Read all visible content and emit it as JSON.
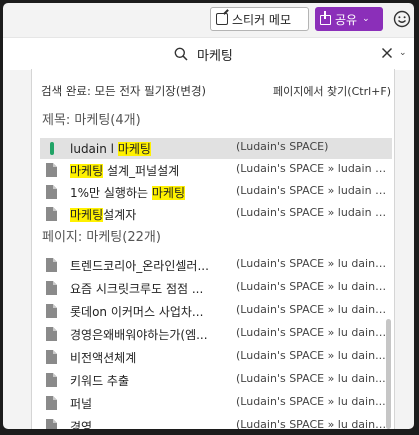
{
  "toolbar": {
    "sticker_label": "스티커 메모",
    "share_label": "공유",
    "share_chevron": "⌄",
    "colors": {
      "share_bg": "#8b2fb9"
    }
  },
  "search": {
    "value": "마케팅",
    "placeholder": "",
    "clear_glyph": "✕",
    "dropdown_glyph": "⌄"
  },
  "panel": {
    "scope_label": "검색 완료:",
    "scope_value": "모든 전자 필기장(변경)",
    "find_in_page": "페이지에서 찾기(Ctrl+F)",
    "sections": [
      {
        "title": "제목:  마케팅(4개)",
        "rows": [
          {
            "icon": "section-tab",
            "pre": "ludain l ",
            "hl": "마케팅",
            "post": "",
            "path": "(Ludain's SPACE)",
            "selected": true
          },
          {
            "icon": "page",
            "pre": "",
            "hl": "마케팅",
            "post": " 설계_퍼널설계",
            "path": "(Ludain's SPACE » ludain l...",
            "selected": false
          },
          {
            "icon": "page",
            "pre": "1%만 실행하는 ",
            "hl": "마케팅",
            "post": "",
            "path": "(Ludain's SPACE » ludain l...",
            "selected": false
          },
          {
            "icon": "page",
            "pre": "",
            "hl": "마케팅",
            "post": "설계자",
            "path": "(Ludain's SPACE » ludain l...",
            "selected": false
          }
        ]
      },
      {
        "title": "페이지:  마케팅(22개)",
        "rows": [
          {
            "icon": "page",
            "pre": "트렌드코리아_온라인셀러...",
            "hl": "",
            "post": "",
            "path": "(Ludain's SPACE » lu dainl...",
            "selected": false
          },
          {
            "icon": "page",
            "pre": "요즘 시크릿크루도 점점 ...",
            "hl": "",
            "post": "",
            "path": "(Ludain's SPACE » lu dainl...",
            "selected": false
          },
          {
            "icon": "page",
            "pre": "롯데on 이커머스 사업차...",
            "hl": "",
            "post": "",
            "path": "(Ludain's SPACE » lu dainl...",
            "selected": false
          },
          {
            "icon": "page",
            "pre": "경영은왜배워야하는가(엠...",
            "hl": "",
            "post": "",
            "path": "(Ludain's SPACE » lu dainl...",
            "selected": false
          },
          {
            "icon": "page",
            "pre": "비전액션체계",
            "hl": "",
            "post": "",
            "path": "(Ludain's SPACE » lu dain...",
            "selected": false
          },
          {
            "icon": "page",
            "pre": "키워드 추출",
            "hl": "",
            "post": "",
            "path": "(Ludain's SPACE » lu dain...",
            "selected": false
          },
          {
            "icon": "page",
            "pre": "퍼널",
            "hl": "",
            "post": "",
            "path": "(Ludain's SPACE » lu dain...",
            "selected": false
          },
          {
            "icon": "page",
            "pre": "경영",
            "hl": "",
            "post": "",
            "path": "(Ludain's SPACE » lu dainl...",
            "selected": false
          }
        ]
      }
    ]
  },
  "colors": {
    "highlight": "#fff100",
    "selected_row": "#e1e1e1",
    "tab_green": "#21a366"
  }
}
